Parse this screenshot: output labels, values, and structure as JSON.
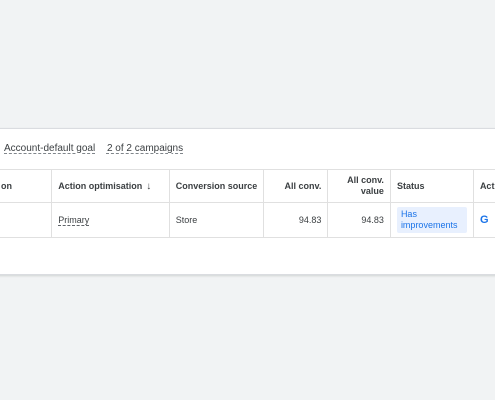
{
  "meta": {
    "goal_label": "Account-default goal",
    "campaigns_label": "2 of 2 campaigns"
  },
  "table": {
    "headers": {
      "action": "on",
      "optimisation": "Action optimisation",
      "sort_icon": "↓",
      "source": "Conversion source",
      "all_conv": "All conv.",
      "all_conv_value": "All conv. value",
      "status": "Status",
      "actions": "Acti"
    },
    "row": {
      "action": "",
      "optimisation": "Primary",
      "source": "Store",
      "all_conv": "94.83",
      "all_conv_value": "94.83",
      "status": "Has improvements",
      "actions": "G"
    }
  },
  "colors": {
    "accent": "#1a73e8",
    "chip_bg": "#e8f0fe",
    "background": "#f1f3f4"
  },
  "icons": {
    "sort": "arrow-down-icon"
  }
}
